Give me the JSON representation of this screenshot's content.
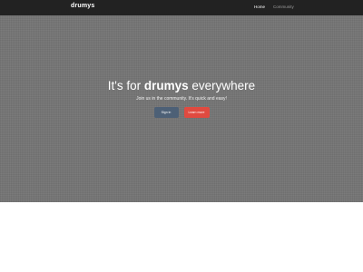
{
  "navbar": {
    "brand": "drumys",
    "links": [
      {
        "label": "Home",
        "active": true
      },
      {
        "label": "Community",
        "active": false
      }
    ]
  },
  "hero": {
    "headline_prefix": "It's for ",
    "headline_emphasis": "drumys",
    "headline_suffix": " everywhere",
    "subtext": "Join us in the community. It's quick and easy!",
    "signin_label": "Sign in",
    "learn_label": "Learn more"
  },
  "colors": {
    "navbar_bg": "#222222",
    "hero_bg": "#7b7b7b",
    "signin_button": "#4d6076",
    "learn_button": "#e04a40"
  }
}
